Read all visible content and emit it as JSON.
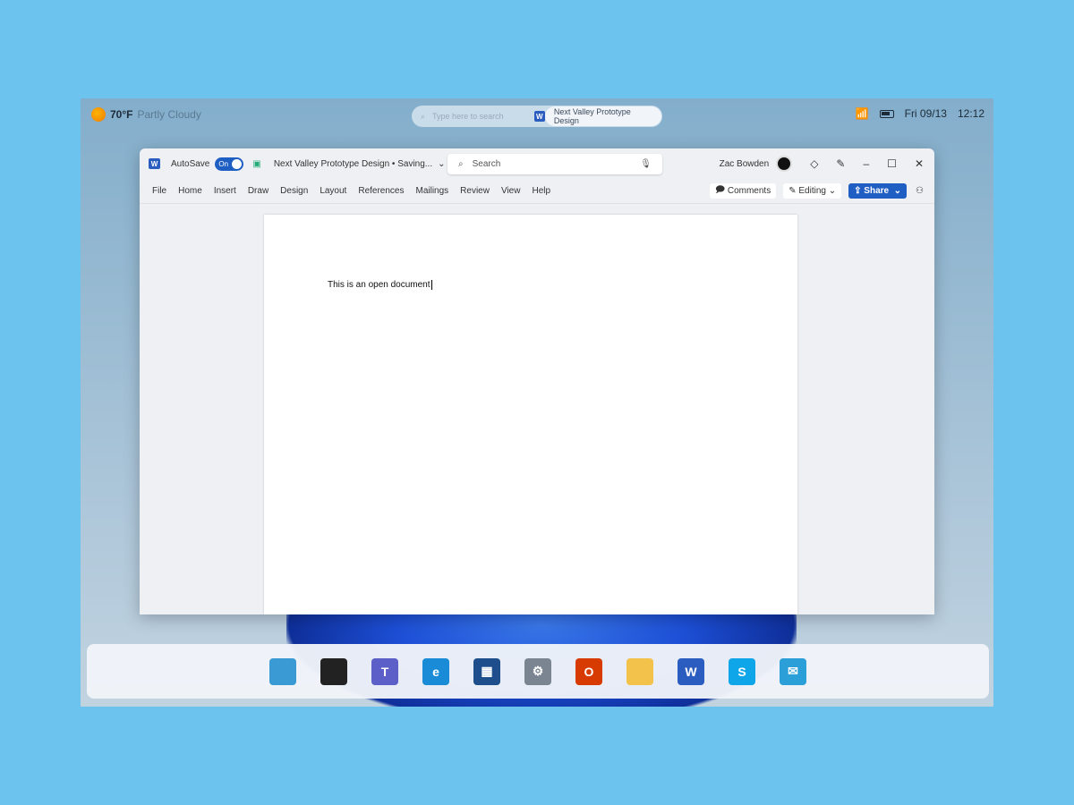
{
  "topbar": {
    "temperature": "70°F",
    "condition": "Partly Cloudy",
    "search_placeholder": "Type here to search",
    "active_doc": "Next Valley Prototype Design",
    "date": "Fri 09/13",
    "time": "12:12"
  },
  "window": {
    "autosave_label": "AutoSave",
    "autosave_state": "On",
    "doc_title": "Next Valley Prototype Design • Saving...",
    "search_placeholder": "Search",
    "user": "Zac Bowden",
    "menu": [
      "File",
      "Home",
      "Insert",
      "Draw",
      "Design",
      "Layout",
      "References",
      "Mailings",
      "Review",
      "View",
      "Help"
    ],
    "comments": "Comments",
    "editing": "Editing",
    "share": "Share"
  },
  "document": {
    "text": "This is an open document"
  },
  "taskbar": {
    "apps": [
      {
        "name": "start",
        "color": "#3a9bd4",
        "glyph": ""
      },
      {
        "name": "task-view",
        "color": "#222",
        "glyph": ""
      },
      {
        "name": "teams",
        "color": "#5b5fc7",
        "glyph": "T"
      },
      {
        "name": "edge",
        "color": "#1a8bd6",
        "glyph": "e"
      },
      {
        "name": "store",
        "color": "#1e4e8c",
        "glyph": "▦"
      },
      {
        "name": "settings",
        "color": "#7a8591",
        "glyph": "⚙"
      },
      {
        "name": "office",
        "color": "#d83b01",
        "glyph": "O"
      },
      {
        "name": "file-explorer",
        "color": "#f3c24a",
        "glyph": ""
      },
      {
        "name": "word",
        "color": "#2b5cbf",
        "glyph": "W"
      },
      {
        "name": "skype",
        "color": "#0ea5e9",
        "glyph": "S"
      },
      {
        "name": "mail",
        "color": "#2a9fd8",
        "glyph": "✉"
      }
    ]
  }
}
